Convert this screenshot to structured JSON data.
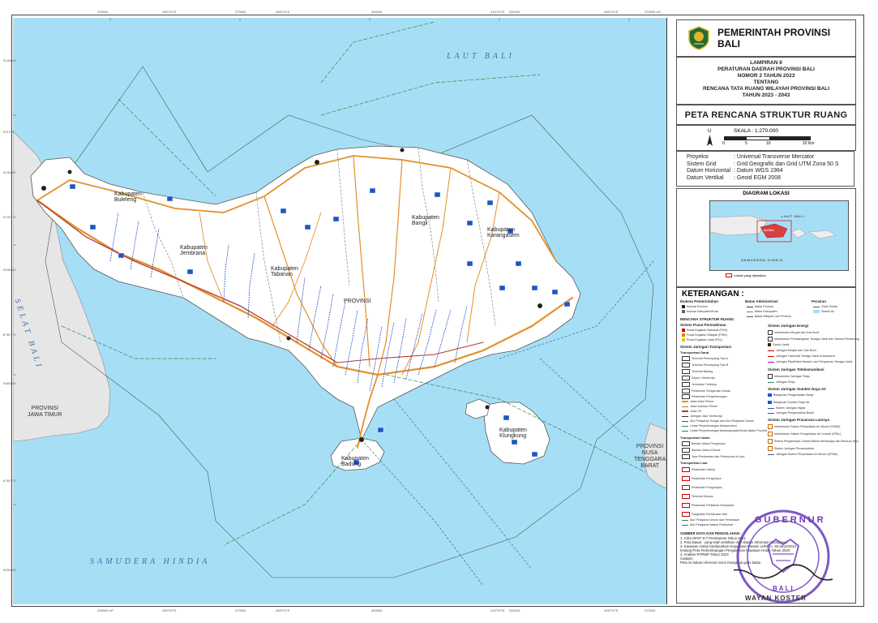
{
  "header": {
    "org_title": "PEMERINTAH PROVINSI BALI",
    "lampiran": [
      "LAMPIRAN II",
      "PERATURAN DAERAH PROVINSI BALI",
      "NOMOR  2  TAHUN 2023",
      "TENTANG",
      "RENCANA TATA RUANG WILAYAH PROVINSI BALI",
      "TAHUN 2023 - 2043"
    ],
    "map_title": "PETA RENCANA STRUKTUR RUANG"
  },
  "scale": {
    "north": "U",
    "label": "SKALA : 1:270.000",
    "ticks": [
      "0",
      "5",
      "10",
      "20 Km"
    ]
  },
  "projection": [
    {
      "k": "Proyeksi",
      "v": "Universal Transverse Mercator"
    },
    {
      "k": "Sistem Grid",
      "v": "Grid Geografis dan Grid UTM Zona 50 S"
    },
    {
      "k": "Datum Horizontal",
      "v": "Datum WGS 1984"
    },
    {
      "k": "Datum Vertikal",
      "v": "Geoid EGM 2008"
    }
  ],
  "inset": {
    "title": "DIAGRAM LOKASI",
    "laut_bali": "LAUT BALI",
    "samudera": "SAMUDERA HINDIA",
    "bali": "Bali/Bali",
    "note": "Lokasi yang dipetakan"
  },
  "map": {
    "sea_labels": {
      "laut_bali": "LAUT BALI",
      "selat_bali": "SELAT BALI",
      "samudera": "SAMUDERA HINDIA"
    },
    "province_labels": {
      "jatim": [
        "PROVINSI",
        "JAWA TIMUR"
      ],
      "ntb": [
        "PROVINSI",
        "NUSA",
        "TENGGARA",
        "BARAT"
      ]
    },
    "regencies": [
      "Kabupaten Buleleng",
      "Kabupaten Jembrana",
      "Kabupaten Tabanan",
      "Kabupaten Bangli",
      "Kabupaten Karangasem",
      "Kabupaten Klungkung",
      "Kabupaten Badung",
      "PROVINSI"
    ],
    "top_coords": [
      "239000",
      "255°0'0\"E",
      "270000",
      "285°0'0\"E",
      "300000",
      "315°0'0\"E",
      "330000",
      "345°0'0\"E",
      "370000 mT"
    ],
    "bottom_coords": [
      "239000 mT",
      "255°0'0\"E",
      "270000",
      "285°0'0\"E",
      "300000",
      "315°0'0\"E",
      "330000",
      "345°0'0\"E",
      "370000"
    ],
    "left_coords": [
      "9148000",
      "8°0'0\"S",
      "9130000",
      "8°15'0\"S",
      "9100000",
      "8°30'0\"S",
      "9060000",
      "8°45'0\"S",
      "9030000"
    ],
    "right_coords": [
      "9148000",
      "9130000",
      "9100000",
      "9060000",
      "9030000"
    ]
  },
  "legend": {
    "title": "KETERANGAN :",
    "col1": {
      "h_ibukota": "Ibukota Pemerintahan",
      "ibukota": [
        "Ibukota Provinsi",
        "Ibukota Kabupaten/Kota"
      ],
      "h_rencana": "RENCANA STRUKTUR RUANG",
      "h_pusat": "Sistem Pusat Permukiman",
      "pusat": [
        "Pusat Kegiatan Nasional (PKN)",
        "Pusat Kegiatan Wilayah (PKW)",
        "Pusat Kegiatan Lokal (PKL)"
      ],
      "h_transport": "Sistem Jaringan Transportasi",
      "h_darat": "Transportasi Darat",
      "darat": [
        "Terminal Penumpang Tipe A",
        "Terminal Penumpang Tipe B",
        "Terminal Barang",
        "Depot / Kereta Api",
        "Jembatan Timbang",
        "Pelabuhan Sungai dan Danau",
        "Pelabuhan Penyeberangan",
        "Jalan Arteri Primer",
        "Jalan Kolektor Primer",
        "Jalan Tol",
        "Jaringan Jalur Kereta Api",
        "Alur Pelayaran Sungai dan Alur Pelayaran Danau",
        "Lintas Penyeberangan Antarprovinsi",
        "Lintas Penyeberangan Antarkabupaten/Kota dalam Provinsi"
      ],
      "h_udara": "Transportasi Udara",
      "udara": [
        "Bandar Udara Pengumpul",
        "Bandar Udara Khusus",
        "Jalur Pendaratan dan Peluncuran di Laut"
      ],
      "h_laut": "Transportasi Laut",
      "laut": [
        "Pelabuhan Utama",
        "Pelabuhan Pengumpul",
        "Pelabuhan Pengumpan",
        "Terminal Khusus",
        "Pelabuhan Perikanan Nusantara",
        "Pangkalan Pendaratan Ikan",
        "Alur Pelayaran Umum dan Perlintasan",
        "Alur Pelayaran Masuk Pelabuhan"
      ]
    },
    "col2": {
      "h_batas": "Batas Administrasi",
      "batas": [
        "Batas Provinsi",
        "Batas Kabupaten",
        "Batas Wilayah Laut Provinsi"
      ],
      "h_energi": "Sistem Jaringan Energi",
      "energi": [
        "Infrastruktur Minyak dan Gas Bumi",
        "Infrastruktur Pembangkitan Tenaga Listrik dan Sarana Pendukung",
        "Gardu Listrik",
        "Jaringan Minyak dan Gas Bumi",
        "Jaringan Transmisi Tenaga Listrik Antarsistem",
        "Jaringan Pipa/Kabel Bawah Laut Penyaluran Tenaga Listrik"
      ],
      "h_telko": "Sistem Jaringan Telekomunikasi",
      "telko": [
        "Infrastruktur Jaringan Tetap",
        "Jaringan Tetap"
      ],
      "h_air": "Sistem Jaringan Sumber Daya Air",
      "air": [
        "Bangunan Pengendalian Banjir",
        "Bangunan Sumber Daya Air",
        "Sistem Jaringan Irigasi",
        "Jaringan Pengendalian Banjir"
      ],
      "h_prasarana": "Sistem Jaringan Prasarana Lainnya",
      "prasarana": [
        "Infrastruktur Sistem Penyediaan Air Minum (SPAM)",
        "Infrastruktur Sistem Pengelolaan Air Limbah (SPAL)",
        "Sistem Pengelolaan Limbah Bahan Berbahaya dan Beracun (B3)",
        "Sistem Jaringan Persampahan",
        "Jaringan Sistem Penyediaan Air Minum (SPAM)"
      ]
    },
    "col3": {
      "h_perairan": "Perairan",
      "perairan": [
        "Garis Pantai",
        "Sistem Air"
      ]
    }
  },
  "sources": {
    "title": "SUMBER DATA DAN PENGOLAHAN :",
    "items": [
      "1. Citra SPOT 6-7 Perekaman Tahun 2021",
      "2. Peta Dasar : yang telah terbitkan oleh Badan Informasi Geospasial",
      "3. Kawasan Hutan berdasarkan Keputusan Menteri LHK No. SK.6610/2021",
      "   tentang Peta Perkembangan Pengukuhan Kawasan Hutan Tahun 2020",
      "4. Analisis RTRWP Tahun 2023",
      "Catatan :",
      "Peta ini bukan referensi resmi mengenai garis batas"
    ]
  },
  "stamp": {
    "top_text": "GUBERNUR",
    "bottom_text": "BALI",
    "signer": "WAYAN KOSTER"
  },
  "colors": {
    "sea": "#a6dff5",
    "land": "#ffffff",
    "neighbor": "#e6e6e6",
    "road_arteri": "#e3902c",
    "road_kolektor": "#c77a1a",
    "rail": "#b23b2e",
    "boundary": "#6e6e6e",
    "marine_boundary": "#2f8a4d",
    "river": "#2a57c7",
    "header_green": "#1f6d3a"
  }
}
